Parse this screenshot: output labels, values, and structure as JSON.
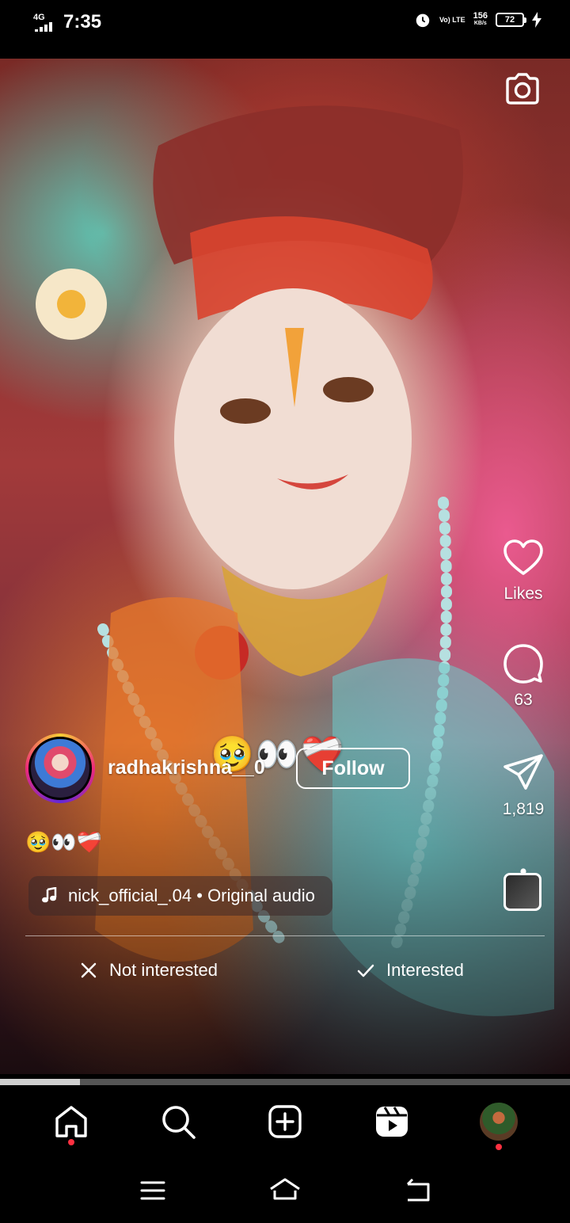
{
  "status_bar": {
    "network": "4G",
    "time": "7:35",
    "volte": "Vo) LTE",
    "speed_value": "156",
    "speed_unit": "KB/s",
    "battery": "72"
  },
  "reel": {
    "caption_overlay": "🥹👀❤️‍🩹",
    "username": "radhakrishna__0⁠",
    "follow_label": "Follow",
    "caption": "🥹👀❤️‍🩹",
    "audio": "nick_official_.04 • Original audio",
    "likes_label": "Likes",
    "comments_count": "63",
    "shares_count": "1,819",
    "progress_fraction": 0.14
  },
  "feedback": {
    "not_interested": "Not interested",
    "interested": "Interested"
  },
  "icons": {
    "camera": "camera-icon",
    "like": "heart-icon",
    "comment": "comment-icon",
    "share": "send-icon",
    "more": "more-vertical-icon",
    "music": "music-note-icon"
  },
  "bottom_nav": [
    "home-icon",
    "search-icon",
    "create-icon",
    "reels-icon",
    "profile-avatar"
  ],
  "colors": {
    "notification_dot": "#ff3040",
    "background": "#000000"
  }
}
